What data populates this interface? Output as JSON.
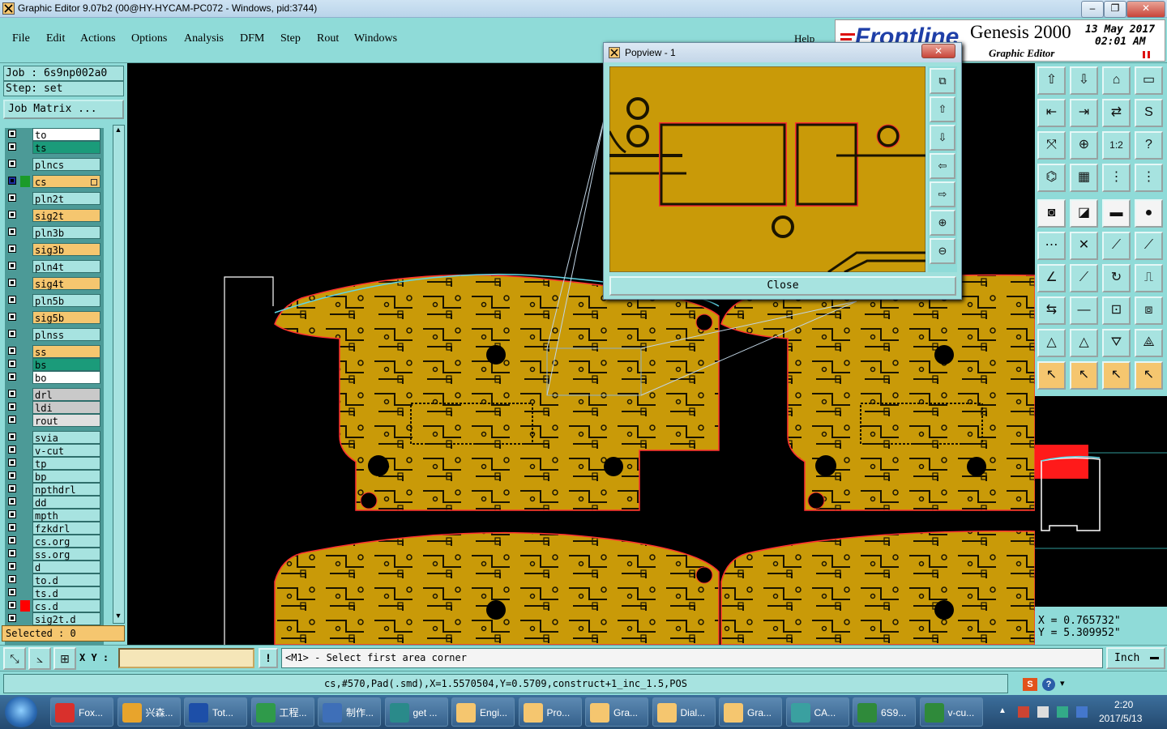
{
  "window": {
    "title": "Graphic Editor 9.07b2 (00@HY-HYCAM-PC072 - Windows, pid:3744)",
    "min_glyph": "–",
    "max_glyph": "❐",
    "close_glyph": "✕"
  },
  "menu": {
    "items": [
      "File",
      "Edit",
      "Actions",
      "Options",
      "Analysis",
      "DFM",
      "Step",
      "Rout",
      "Windows"
    ],
    "help": "Help"
  },
  "brand": {
    "logo": "Frontline",
    "product": "Genesis 2000",
    "subtitle": "Graphic Editor",
    "date": "13 May 2017",
    "time": "02:01 AM"
  },
  "job": {
    "job_label": "Job : 6s9np002a0",
    "step_label": "Step: set",
    "matrix_button": "Job Matrix ..."
  },
  "layers": [
    {
      "name": "to",
      "color": "#ffffff"
    },
    {
      "name": "ts",
      "color": "#1b9b7a"
    },
    {
      "name": "plncs",
      "color": "#a7e3e0"
    },
    {
      "name": "cs",
      "color": "#f5c66f",
      "active": true
    },
    {
      "name": "pln2t",
      "color": "#a7e3e0"
    },
    {
      "name": "sig2t",
      "color": "#f5c66f"
    },
    {
      "name": "pln3b",
      "color": "#a7e3e0"
    },
    {
      "name": "sig3b",
      "color": "#f5c66f"
    },
    {
      "name": "pln4t",
      "color": "#a7e3e0"
    },
    {
      "name": "sig4t",
      "color": "#f5c66f"
    },
    {
      "name": "pln5b",
      "color": "#a7e3e0"
    },
    {
      "name": "sig5b",
      "color": "#f5c66f"
    },
    {
      "name": "plnss",
      "color": "#a7e3e0"
    },
    {
      "name": "ss",
      "color": "#f5c66f"
    },
    {
      "name": "bs",
      "color": "#1b9b7a"
    },
    {
      "name": "bo",
      "color": "#ffffff"
    },
    {
      "name": "drl",
      "color": "#c9c9c9"
    },
    {
      "name": "ldi",
      "color": "#c9c9c9"
    },
    {
      "name": "rout",
      "color": "#e0e0e0"
    },
    {
      "name": "svia",
      "color": "#a7e3e0"
    },
    {
      "name": "v-cut",
      "color": "#a7e3e0"
    },
    {
      "name": "tp",
      "color": "#a7e3e0"
    },
    {
      "name": "bp",
      "color": "#a7e3e0"
    },
    {
      "name": "npthdrl",
      "color": "#a7e3e0"
    },
    {
      "name": "dd",
      "color": "#a7e3e0"
    },
    {
      "name": "mpth",
      "color": "#a7e3e0"
    },
    {
      "name": "fzkdrl",
      "color": "#a7e3e0"
    },
    {
      "name": "cs.org",
      "color": "#a7e3e0"
    },
    {
      "name": "ss.org",
      "color": "#a7e3e0"
    },
    {
      "name": "d",
      "color": "#a7e3e0"
    },
    {
      "name": "to.d",
      "color": "#a7e3e0"
    },
    {
      "name": "ts.d",
      "color": "#a7e3e0"
    },
    {
      "name": "cs.d",
      "color": "#a7e3e0",
      "marker": "#ff0000"
    },
    {
      "name": "sig2t.d",
      "color": "#a7e3e0"
    }
  ],
  "selected": "Selected : 0",
  "popview": {
    "title": "Popview - 1",
    "close_button": "Close"
  },
  "coords": {
    "x": "X = 0.765732\"",
    "y": "Y = 5.309952\""
  },
  "command": {
    "xy_label": "X Y :",
    "xy_value": "",
    "alert_icon": "!",
    "prompt": "<M1> - Select first area corner",
    "unit": "Inch"
  },
  "status": "cs,#570,Pad(.smd),X=1.5570504,Y=0.5709,construct+1_inc_1.5,POS",
  "taskbar": {
    "items": [
      "Fox...",
      "兴森...",
      "Tot...",
      "工程...",
      "制作...",
      "get ...",
      "Engi...",
      "Pro...",
      "Gra...",
      "Dial...",
      "Gra...",
      "CA...",
      "6S9...",
      "v-cu..."
    ],
    "clock_time": "2:20",
    "clock_date": "2017/5/13"
  },
  "colors": {
    "panel": "#8fdbd8",
    "copper": "#c99a08",
    "outline": "#ff3030",
    "accent_orange": "#f5c66f"
  }
}
